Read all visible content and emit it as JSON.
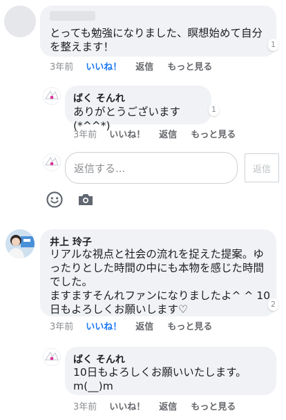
{
  "comments": [
    {
      "author": "",
      "text": "とっても勉強になりました、瞑想始めて自分\nを整えます！",
      "reaction_count": "1",
      "time": "3年前",
      "like": "いいね！",
      "reply": "返信",
      "more": "もっと見る",
      "reply_comment": {
        "author": "ばく そんれ",
        "text": "ありがとうございます(*^^*)",
        "reaction_count": "1",
        "time": "3年前",
        "like": "いいね！",
        "reply": "返信",
        "more": "もっと見る"
      }
    },
    {
      "author": "井上 玲子",
      "text": "リアルな視点と社会の流れを捉えた提案。ゆ\nったりとした時間の中にも本物を感じた時間\nでした。\nますますそんれファンになりましたよ^ ^ 10\n日もよろしくお願いします♡",
      "reaction_count": "2",
      "time": "3年前",
      "like": "いいね！",
      "reply": "返信",
      "more": "もっと見る",
      "reply_comment": {
        "author": "ばく そんれ",
        "text": "10日もよろしくお願いいたします。\nm(__)m",
        "time": "3年前",
        "like": "いいね！",
        "reply": "返信",
        "more": "もっと見る"
      }
    }
  ],
  "reply_box": {
    "placeholder": "返信する...",
    "button": "返信",
    "icons": [
      "smiley-icon",
      "camera-icon"
    ]
  },
  "colors": {
    "like_active": "#1877f2",
    "bubble": "#f0f2f5",
    "meta": "#65676b"
  }
}
